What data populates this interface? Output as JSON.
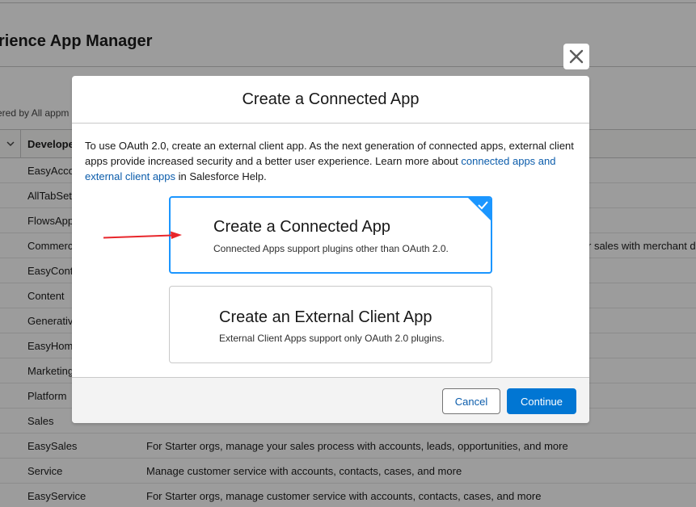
{
  "background": {
    "title": "rience App Manager",
    "subtitle": "ered by All appm",
    "column_header": "Develope",
    "rows": [
      {
        "name": "EasyAcco",
        "desc": ""
      },
      {
        "name": "AllTabSet",
        "desc": ""
      },
      {
        "name": "FlowsApp",
        "desc": ""
      },
      {
        "name": "Commerc",
        "desc": "r sales with merchant d"
      },
      {
        "name": "EasyConta",
        "desc": ""
      },
      {
        "name": "Content",
        "desc": ""
      },
      {
        "name": "Generativ",
        "desc": ""
      },
      {
        "name": "EasyHome",
        "desc": ""
      },
      {
        "name": "Marketing",
        "desc": ""
      },
      {
        "name": "Platform",
        "desc": ""
      },
      {
        "name": "Sales",
        "desc": ""
      },
      {
        "name": "EasySales",
        "desc": "For Starter orgs, manage your sales process with accounts, leads, opportunities, and more"
      },
      {
        "name": "Service",
        "desc": "Manage customer service with accounts, contacts, cases, and more"
      },
      {
        "name": "EasyService",
        "desc": "For Starter orgs, manage customer service with accounts, contacts, cases, and more"
      }
    ]
  },
  "modal": {
    "title": "Create a Connected App",
    "body_text_1": "To use OAuth 2.0, create an external client app. As the next generation of connected apps, external client apps provide increased security and a better user experience. Learn more about ",
    "body_link": "connected apps and external client apps",
    "body_text_2": " in Salesforce Help.",
    "options": [
      {
        "title": "Create a Connected App",
        "description": "Connected Apps support plugins other than OAuth 2.0.",
        "selected": true
      },
      {
        "title": "Create an External Client App",
        "description": "External Client Apps support only OAuth 2.0 plugins.",
        "selected": false
      }
    ],
    "cancel_label": "Cancel",
    "continue_label": "Continue"
  },
  "colors": {
    "brand_blue": "#0176d3",
    "selected_border": "#1b96ff",
    "link": "#0b5cab",
    "annotation_arrow": "#e8262b"
  },
  "icons": {
    "close": "close-icon",
    "check": "check-icon",
    "chevron": "chevron-down-icon",
    "arrow": "red-arrow-annotation"
  }
}
